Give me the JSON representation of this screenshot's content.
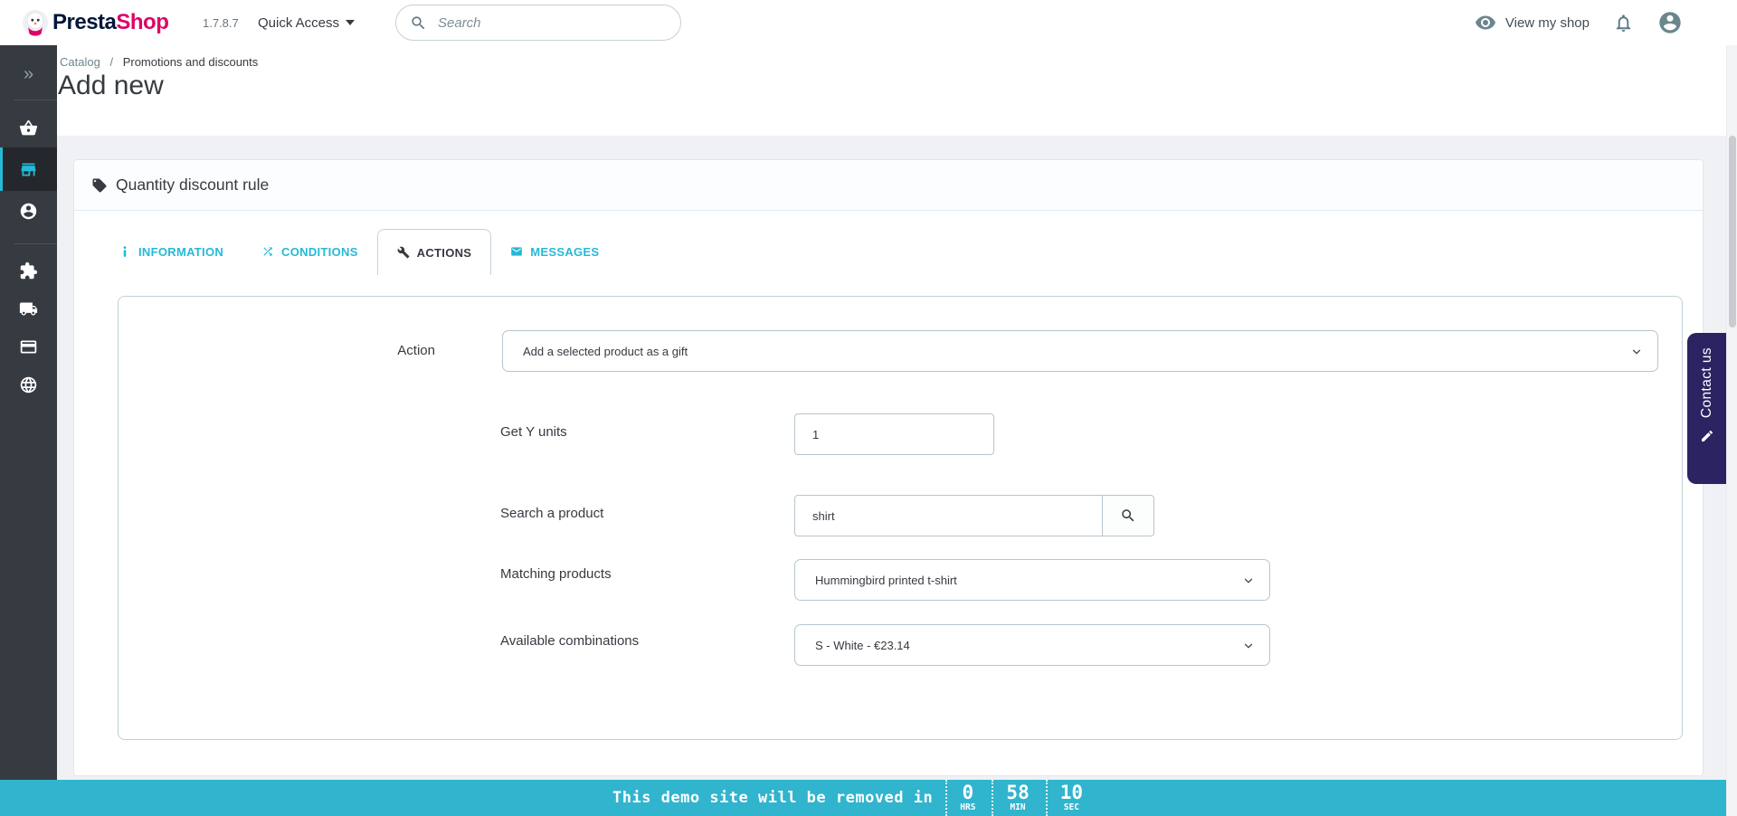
{
  "topbar": {
    "brand_presta": "Presta",
    "brand_shop": "Shop",
    "version": "1.7.8.7",
    "quick_access_label": "Quick Access",
    "search_placeholder": "Search",
    "view_my_shop_label": "View my shop"
  },
  "breadcrumb": {
    "parent": "Catalog",
    "separator": "/",
    "current": "Promotions and discounts"
  },
  "page": {
    "title": "Add new"
  },
  "sidebar": {
    "items": [
      {
        "name": "collapse-menu",
        "icon": "double-chevron-icon",
        "glyph": "»",
        "active": false
      },
      {
        "name": "orders",
        "icon": "basket-icon",
        "active": false
      },
      {
        "name": "catalog",
        "icon": "store-icon",
        "active": true
      },
      {
        "name": "customers",
        "icon": "person-icon",
        "active": false
      },
      {
        "name": "modules",
        "icon": "puzzle-icon",
        "active": false
      },
      {
        "name": "shipping",
        "icon": "truck-icon",
        "active": false
      },
      {
        "name": "payment",
        "icon": "credit-card-icon",
        "active": false
      },
      {
        "name": "international",
        "icon": "globe-icon",
        "active": false
      }
    ]
  },
  "panel": {
    "title": "Quantity discount rule",
    "icon": "tag-icon"
  },
  "tabs": {
    "items": [
      {
        "label": "INFORMATION",
        "icon": "info-icon",
        "active": false
      },
      {
        "label": "CONDITIONS",
        "icon": "shuffle-icon",
        "active": false
      },
      {
        "label": "ACTIONS",
        "icon": "wrench-icon",
        "active": true
      },
      {
        "label": "MESSAGES",
        "icon": "envelope-icon",
        "active": false
      }
    ]
  },
  "form": {
    "action_label": "Action",
    "action_value": "Add a selected product as a gift",
    "get_y_units_label": "Get Y units",
    "get_y_units_value": "1",
    "search_product_label": "Search a product",
    "search_product_value": "shirt",
    "matching_products_label": "Matching products",
    "matching_products_value": "Hummingbird printed t-shirt",
    "available_combinations_label": "Available combinations",
    "available_combinations_value": "S - White - €23.14"
  },
  "contact_tab": {
    "label": "Contact us",
    "icon": "pencil-icon"
  },
  "demo_banner": {
    "message": "This demo site will be removed in",
    "countdown": [
      {
        "value": "0",
        "unit": "HRS"
      },
      {
        "value": "58",
        "unit": "MIN"
      },
      {
        "value": "10",
        "unit": "SEC"
      }
    ]
  },
  "colors": {
    "accent_cyan": "#25b9d7",
    "brand_pink": "#df0067",
    "brand_navy": "#011638",
    "sidebar_bg": "#363a41",
    "banner_bg": "#31b4cd",
    "contact_bg": "#2c2363",
    "content_bg": "#eff1f4"
  }
}
